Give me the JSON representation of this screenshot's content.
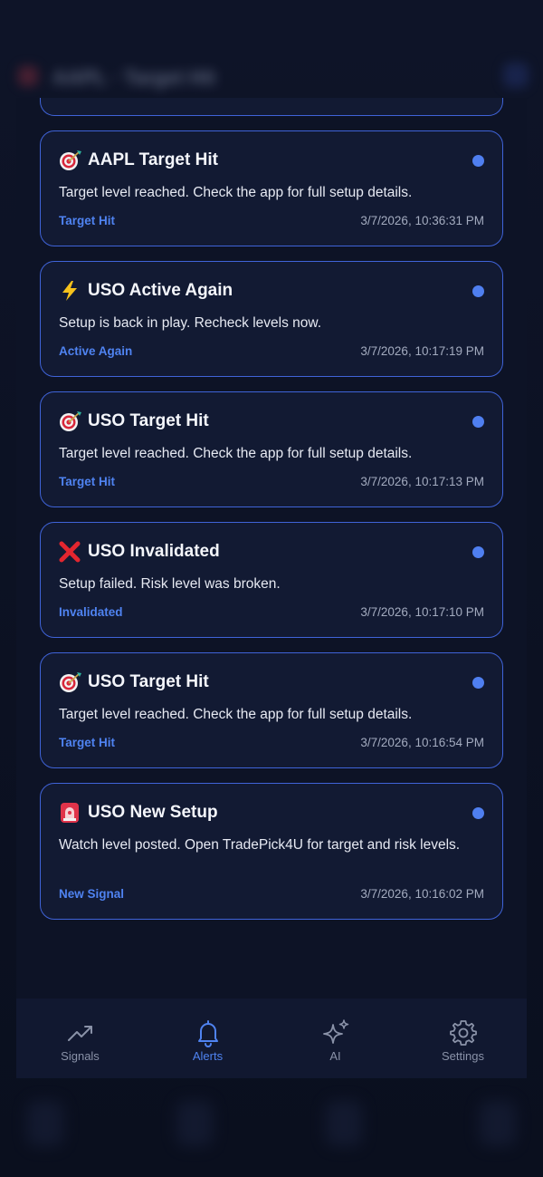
{
  "backdrop": {
    "header_title": "AAPL · Target Hit"
  },
  "alerts": [
    {
      "icon": "target-icon",
      "title": "AAPL Target Hit",
      "body": "Target level reached. Check the app for full setup details.",
      "tag": "Target Hit",
      "time": "3/7/2026, 10:36:31 PM",
      "unread": true
    },
    {
      "icon": "lightning-icon",
      "title": "USO Active Again",
      "body": "Setup is back in play. Recheck levels now.",
      "tag": "Active Again",
      "time": "3/7/2026, 10:17:19 PM",
      "unread": true
    },
    {
      "icon": "target-icon",
      "title": "USO Target Hit",
      "body": "Target level reached. Check the app for full setup details.",
      "tag": "Target Hit",
      "time": "3/7/2026, 10:17:13 PM",
      "unread": true
    },
    {
      "icon": "cross-mark-icon",
      "title": "USO Invalidated",
      "body": "Setup failed. Risk level was broken.",
      "tag": "Invalidated",
      "time": "3/7/2026, 10:17:10 PM",
      "unread": true
    },
    {
      "icon": "target-icon",
      "title": "USO Target Hit",
      "body": "Target level reached. Check the app for full setup details.",
      "tag": "Target Hit",
      "time": "3/7/2026, 10:16:54 PM",
      "unread": true
    },
    {
      "icon": "siren-icon",
      "title": "USO New Setup",
      "body": "Watch level posted. Open TradePick4U for target and risk levels.",
      "tag": "New Signal",
      "time": "3/7/2026, 10:16:02 PM",
      "unread": true
    }
  ],
  "tabs": [
    {
      "icon": "trending-up-icon",
      "label": "Signals",
      "active": false
    },
    {
      "icon": "bell-icon",
      "label": "Alerts",
      "active": true
    },
    {
      "icon": "sparkles-icon",
      "label": "AI",
      "active": false
    },
    {
      "icon": "gear-icon",
      "label": "Settings",
      "active": false
    }
  ],
  "colors": {
    "accent": "#4f83f1",
    "card_border": "#3f63d8",
    "card_bg": "#121a33",
    "unread_dot": "#4f7ff0"
  }
}
